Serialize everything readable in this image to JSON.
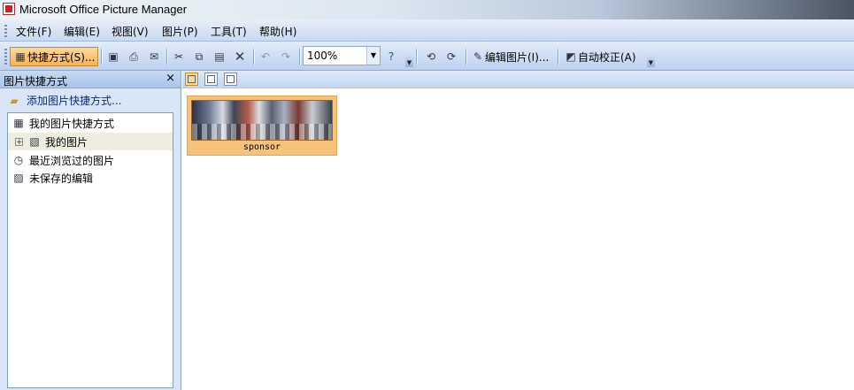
{
  "window": {
    "title": "Microsoft Office Picture Manager"
  },
  "menu": [
    {
      "label": "文件(F)"
    },
    {
      "label": "编辑(E)"
    },
    {
      "label": "视图(V)"
    },
    {
      "label": "图片(P)"
    },
    {
      "label": "工具(T)"
    },
    {
      "label": "帮助(H)"
    }
  ],
  "toolbar": {
    "shortcuts_label": "快捷方式(S)...",
    "zoom_value": "100%",
    "edit_picture_label": "编辑图片(I)...",
    "auto_correct_label": "自动校正(A)"
  },
  "pane": {
    "title": "图片快捷方式",
    "close_glyph": "×",
    "add_shortcut_label": "添加图片快捷方式...",
    "tree": [
      {
        "label": "我的图片快捷方式"
      },
      {
        "label": "我的图片"
      },
      {
        "label": "最近浏览过的图片"
      },
      {
        "label": "未保存的编辑"
      }
    ]
  },
  "thumbnails": [
    {
      "caption": "sponsor"
    }
  ],
  "colors": {
    "accent": "#f7c27a",
    "toolbar": "#c8d9f1",
    "pane": "#d9e6f7"
  }
}
